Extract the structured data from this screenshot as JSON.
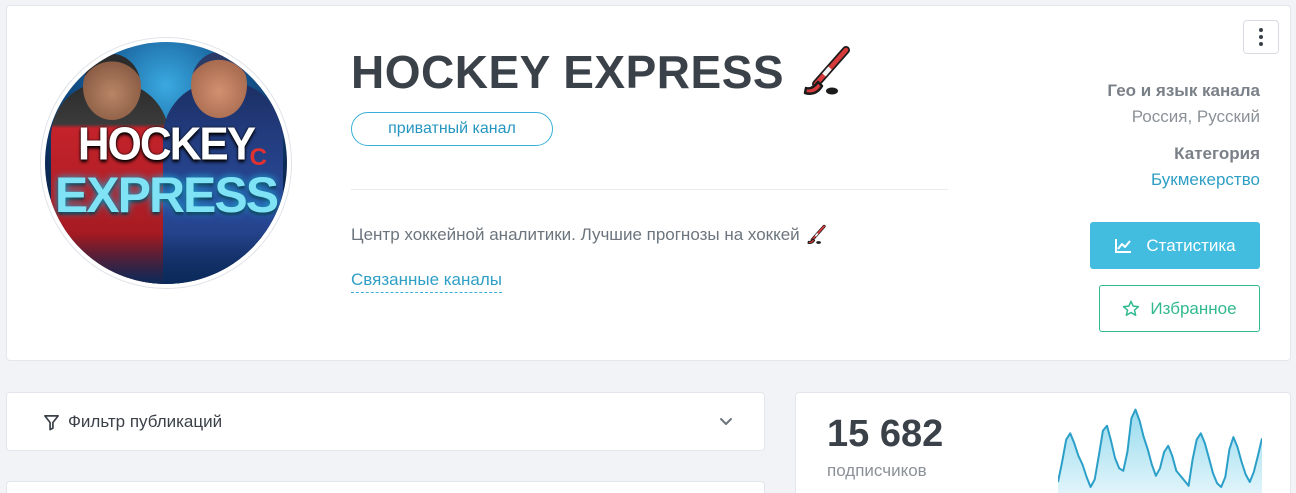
{
  "channel": {
    "title": "HOCKEY EXPRESS",
    "badge": "приватный канал",
    "description": "Центр хоккейной аналитики. Лучшие прогнозы на хоккей",
    "related_link": "Связанные каналы",
    "avatar": {
      "logo_line1": "HOCKEY",
      "logo_line2": "EXPRESS",
      "jersey_letter": "C"
    }
  },
  "meta": {
    "geo_label": "Гео и язык канала",
    "geo_value": "Россия, Русский",
    "category_label": "Категория",
    "category_value": "Букмекерство"
  },
  "actions": {
    "stats_label": "Статистика",
    "favorite_label": "Избранное"
  },
  "filter": {
    "label": "Фильтр публикаций"
  },
  "subscribers": {
    "count": "15 682",
    "label": "подписчиков",
    "trend": [
      22,
      38,
      56,
      61,
      53,
      43,
      36,
      26,
      18,
      24,
      43,
      63,
      67,
      55,
      41,
      33,
      31,
      46,
      73,
      80,
      71,
      58,
      48,
      36,
      27,
      33,
      46,
      51,
      43,
      31,
      27,
      23,
      19,
      40,
      56,
      61,
      53,
      41,
      29,
      21,
      18,
      26,
      48,
      58,
      50,
      38,
      28,
      22,
      30,
      43,
      57
    ]
  },
  "colors": {
    "accent": "#42bde0",
    "link": "#2f9fc5",
    "success": "#31b98f",
    "title": "#3b4149"
  },
  "icons": {
    "menu": "more-vertical-icon",
    "stick": "hockey-stick-icon",
    "chart": "line-chart-icon",
    "star": "star-icon",
    "filter": "funnel-icon",
    "chevron": "chevron-down-icon"
  }
}
